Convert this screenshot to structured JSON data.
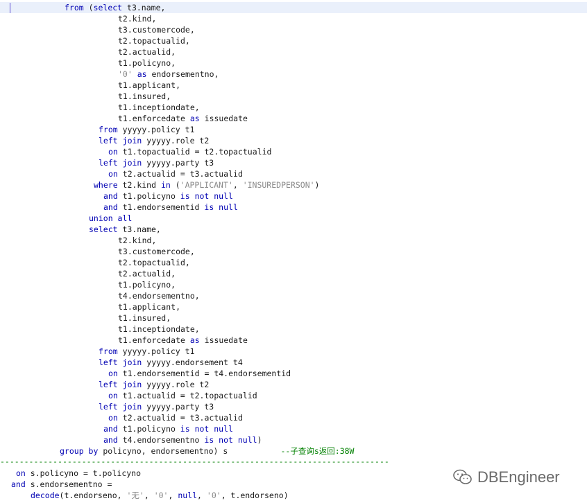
{
  "code_lines": [
    {
      "indent": 13,
      "tokens": [
        {
          "t": "from",
          "c": "kw"
        },
        {
          "t": " ("
        },
        {
          "t": "select",
          "c": "kw"
        },
        {
          "t": " t3.name,"
        }
      ]
    },
    {
      "indent": 24,
      "tokens": [
        {
          "t": "t2.kind,"
        }
      ]
    },
    {
      "indent": 24,
      "tokens": [
        {
          "t": "t3.customercode,"
        }
      ]
    },
    {
      "indent": 24,
      "tokens": [
        {
          "t": "t2.topactualid,"
        }
      ]
    },
    {
      "indent": 24,
      "tokens": [
        {
          "t": "t2.actualid,"
        }
      ]
    },
    {
      "indent": 24,
      "tokens": [
        {
          "t": "t1.policyno,"
        }
      ]
    },
    {
      "indent": 24,
      "tokens": [
        {
          "t": "'0'",
          "c": "str"
        },
        {
          "t": " "
        },
        {
          "t": "as",
          "c": "kw"
        },
        {
          "t": " endorsementno,"
        }
      ]
    },
    {
      "indent": 24,
      "tokens": [
        {
          "t": "t1.applicant,"
        }
      ]
    },
    {
      "indent": 24,
      "tokens": [
        {
          "t": "t1.insured,"
        }
      ]
    },
    {
      "indent": 24,
      "tokens": [
        {
          "t": "t1.inceptiondate,"
        }
      ]
    },
    {
      "indent": 24,
      "tokens": [
        {
          "t": "t1.enforcedate "
        },
        {
          "t": "as",
          "c": "kw"
        },
        {
          "t": " issuedate"
        }
      ]
    },
    {
      "indent": 20,
      "tokens": [
        {
          "t": "from",
          "c": "kw"
        },
        {
          "t": " yyyyy.policy t1"
        }
      ]
    },
    {
      "indent": 20,
      "tokens": [
        {
          "t": "left",
          "c": "kw"
        },
        {
          "t": " "
        },
        {
          "t": "join",
          "c": "kw"
        },
        {
          "t": " yyyyy.role t2"
        }
      ]
    },
    {
      "indent": 22,
      "tokens": [
        {
          "t": "on",
          "c": "kw"
        },
        {
          "t": " t1.topactualid = t2.topactualid"
        }
      ]
    },
    {
      "indent": 20,
      "tokens": [
        {
          "t": "left",
          "c": "kw"
        },
        {
          "t": " "
        },
        {
          "t": "join",
          "c": "kw"
        },
        {
          "t": " yyyyy.party t3"
        }
      ]
    },
    {
      "indent": 22,
      "tokens": [
        {
          "t": "on",
          "c": "kw"
        },
        {
          "t": " t2.actualid = t3.actualid"
        }
      ]
    },
    {
      "indent": 19,
      "tokens": [
        {
          "t": "where",
          "c": "kw"
        },
        {
          "t": " t2.kind "
        },
        {
          "t": "in",
          "c": "kw"
        },
        {
          "t": " ("
        },
        {
          "t": "'APPLICANT'",
          "c": "str"
        },
        {
          "t": ", "
        },
        {
          "t": "'INSUREDPERSON'",
          "c": "str"
        },
        {
          "t": ")"
        }
      ]
    },
    {
      "indent": 21,
      "tokens": [
        {
          "t": "and",
          "c": "kw"
        },
        {
          "t": " t1.policyno "
        },
        {
          "t": "is not null",
          "c": "kw"
        }
      ]
    },
    {
      "indent": 21,
      "tokens": [
        {
          "t": "and",
          "c": "kw"
        },
        {
          "t": " t1.endorsementid "
        },
        {
          "t": "is null",
          "c": "kw"
        }
      ]
    },
    {
      "indent": 18,
      "tokens": [
        {
          "t": "union all",
          "c": "kw"
        }
      ]
    },
    {
      "indent": 18,
      "tokens": [
        {
          "t": "select",
          "c": "kw"
        },
        {
          "t": " t3.name,"
        }
      ]
    },
    {
      "indent": 24,
      "tokens": [
        {
          "t": "t2.kind,"
        }
      ]
    },
    {
      "indent": 24,
      "tokens": [
        {
          "t": "t3.customercode,"
        }
      ]
    },
    {
      "indent": 24,
      "tokens": [
        {
          "t": "t2.topactualid,"
        }
      ]
    },
    {
      "indent": 24,
      "tokens": [
        {
          "t": "t2.actualid,"
        }
      ]
    },
    {
      "indent": 24,
      "tokens": [
        {
          "t": "t1.policyno,"
        }
      ]
    },
    {
      "indent": 24,
      "tokens": [
        {
          "t": "t4.endorsementno,"
        }
      ]
    },
    {
      "indent": 24,
      "tokens": [
        {
          "t": "t1.applicant,"
        }
      ]
    },
    {
      "indent": 24,
      "tokens": [
        {
          "t": "t1.insured,"
        }
      ]
    },
    {
      "indent": 24,
      "tokens": [
        {
          "t": "t1.inceptiondate,"
        }
      ]
    },
    {
      "indent": 24,
      "tokens": [
        {
          "t": "t1.enforcedate "
        },
        {
          "t": "as",
          "c": "kw"
        },
        {
          "t": " issuedate"
        }
      ]
    },
    {
      "indent": 20,
      "tokens": [
        {
          "t": "from",
          "c": "kw"
        },
        {
          "t": " yyyyy.policy t1"
        }
      ]
    },
    {
      "indent": 20,
      "tokens": [
        {
          "t": "left",
          "c": "kw"
        },
        {
          "t": " "
        },
        {
          "t": "join",
          "c": "kw"
        },
        {
          "t": " yyyyy.endorsement t4"
        }
      ]
    },
    {
      "indent": 22,
      "tokens": [
        {
          "t": "on",
          "c": "kw"
        },
        {
          "t": " t1.endorsementid = t4.endorsementid"
        }
      ]
    },
    {
      "indent": 20,
      "tokens": [
        {
          "t": "left",
          "c": "kw"
        },
        {
          "t": " "
        },
        {
          "t": "join",
          "c": "kw"
        },
        {
          "t": " yyyyy.role t2"
        }
      ]
    },
    {
      "indent": 22,
      "tokens": [
        {
          "t": "on",
          "c": "kw"
        },
        {
          "t": " t1.actualid = t2.topactualid"
        }
      ]
    },
    {
      "indent": 20,
      "tokens": [
        {
          "t": "left",
          "c": "kw"
        },
        {
          "t": " "
        },
        {
          "t": "join",
          "c": "kw"
        },
        {
          "t": " yyyyy.party t3"
        }
      ]
    },
    {
      "indent": 22,
      "tokens": [
        {
          "t": "on",
          "c": "kw"
        },
        {
          "t": " t2.actualid = t3.actualid"
        }
      ]
    },
    {
      "indent": 21,
      "tokens": [
        {
          "t": "and",
          "c": "kw"
        },
        {
          "t": " t1.policyno "
        },
        {
          "t": "is not null",
          "c": "kw"
        }
      ]
    },
    {
      "indent": 21,
      "tokens": [
        {
          "t": "and",
          "c": "kw"
        },
        {
          "t": " t4.endorsementno "
        },
        {
          "t": "is not null",
          "c": "kw"
        },
        {
          "t": ")"
        }
      ]
    },
    {
      "indent": 12,
      "tokens": [
        {
          "t": "group by",
          "c": "kw"
        },
        {
          "t": " policyno, endorsementno) s           "
        },
        {
          "t": "--子查询s返回:38W",
          "c": "cm"
        }
      ]
    }
  ],
  "separator": "-------------------------------------------------------------------------------------------------------",
  "tail_lines": [
    {
      "indent": 3,
      "tokens": [
        {
          "t": "on",
          "c": "kw"
        },
        {
          "t": " s.policyno = t.policyno"
        }
      ]
    },
    {
      "indent": 2,
      "tokens": [
        {
          "t": "and",
          "c": "kw"
        },
        {
          "t": " s.endorsementno ="
        }
      ]
    },
    {
      "indent": 6,
      "tokens": [
        {
          "t": "decode",
          "c": "kw"
        },
        {
          "t": "(t.endorseno, "
        },
        {
          "t": "'无'",
          "c": "str"
        },
        {
          "t": ", "
        },
        {
          "t": "'0'",
          "c": "str"
        },
        {
          "t": ", "
        },
        {
          "t": "null",
          "c": "kw"
        },
        {
          "t": ", "
        },
        {
          "t": "'0'",
          "c": "str"
        },
        {
          "t": ", t.endorseno)"
        }
      ]
    }
  ],
  "watermark": {
    "text": "DBEngineer",
    "icon": "wechat-icon"
  },
  "colors": {
    "keyword": "#0000b3",
    "string": "#8a8a8a",
    "comment": "#008000",
    "caret": "#5b4ad0"
  }
}
